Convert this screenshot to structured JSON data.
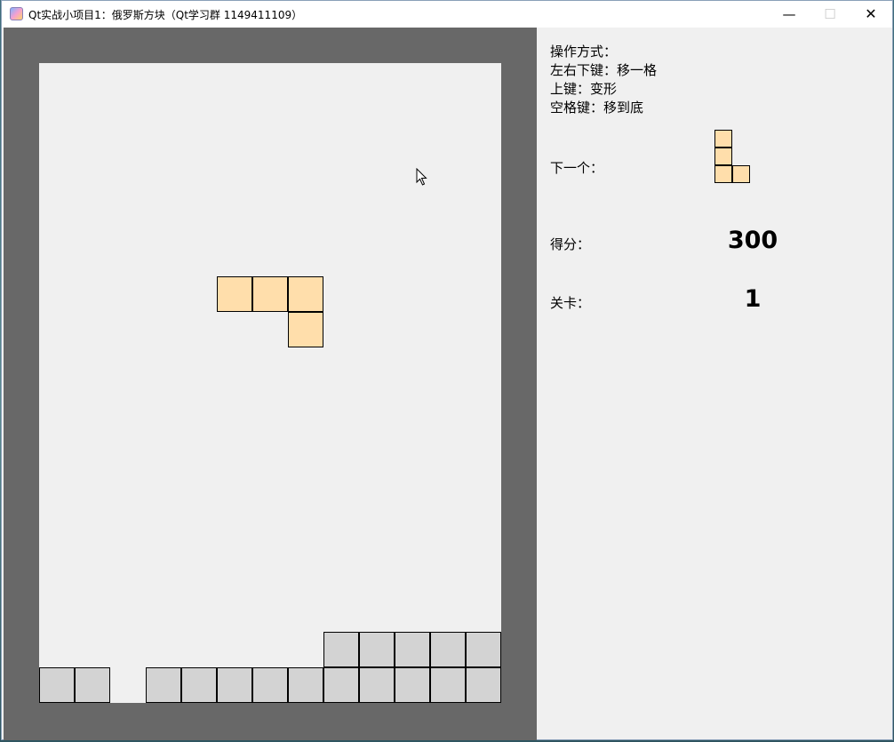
{
  "window": {
    "title": "Qt实战小项目1：俄罗斯方块（Qt学习群 1149411109）"
  },
  "titlebar_buttons": {
    "minimize": "—",
    "maximize": "☐",
    "close": "✕"
  },
  "controls_help": {
    "heading": "操作方式：",
    "lines": [
      "左右下键：移一格",
      "上键：变形",
      "空格键：移到底"
    ]
  },
  "next_piece": {
    "label": "下一个：",
    "shape": "L",
    "cells": [
      [
        0,
        0
      ],
      [
        0,
        1
      ],
      [
        0,
        2
      ],
      [
        1,
        2
      ]
    ]
  },
  "score": {
    "label": "得分：",
    "value": "300"
  },
  "level": {
    "label": "关卡：",
    "value": "1"
  },
  "board": {
    "columns": 13,
    "rows": 18,
    "colors": {
      "background": "#f0f0f0",
      "frame": "#686868",
      "active_block": "#ffdeab",
      "settled_block": "#d3d3d3"
    },
    "active_piece": [
      [
        5,
        6
      ],
      [
        6,
        6
      ],
      [
        7,
        6
      ],
      [
        7,
        7
      ]
    ],
    "settled_blocks": [
      [
        8,
        16
      ],
      [
        9,
        16
      ],
      [
        10,
        16
      ],
      [
        11,
        16
      ],
      [
        12,
        16
      ],
      [
        0,
        17
      ],
      [
        1,
        17
      ],
      [
        3,
        17
      ],
      [
        4,
        17
      ],
      [
        5,
        17
      ],
      [
        6,
        17
      ],
      [
        7,
        17
      ],
      [
        8,
        17
      ],
      [
        9,
        17
      ],
      [
        10,
        17
      ],
      [
        11,
        17
      ],
      [
        12,
        17
      ]
    ]
  }
}
